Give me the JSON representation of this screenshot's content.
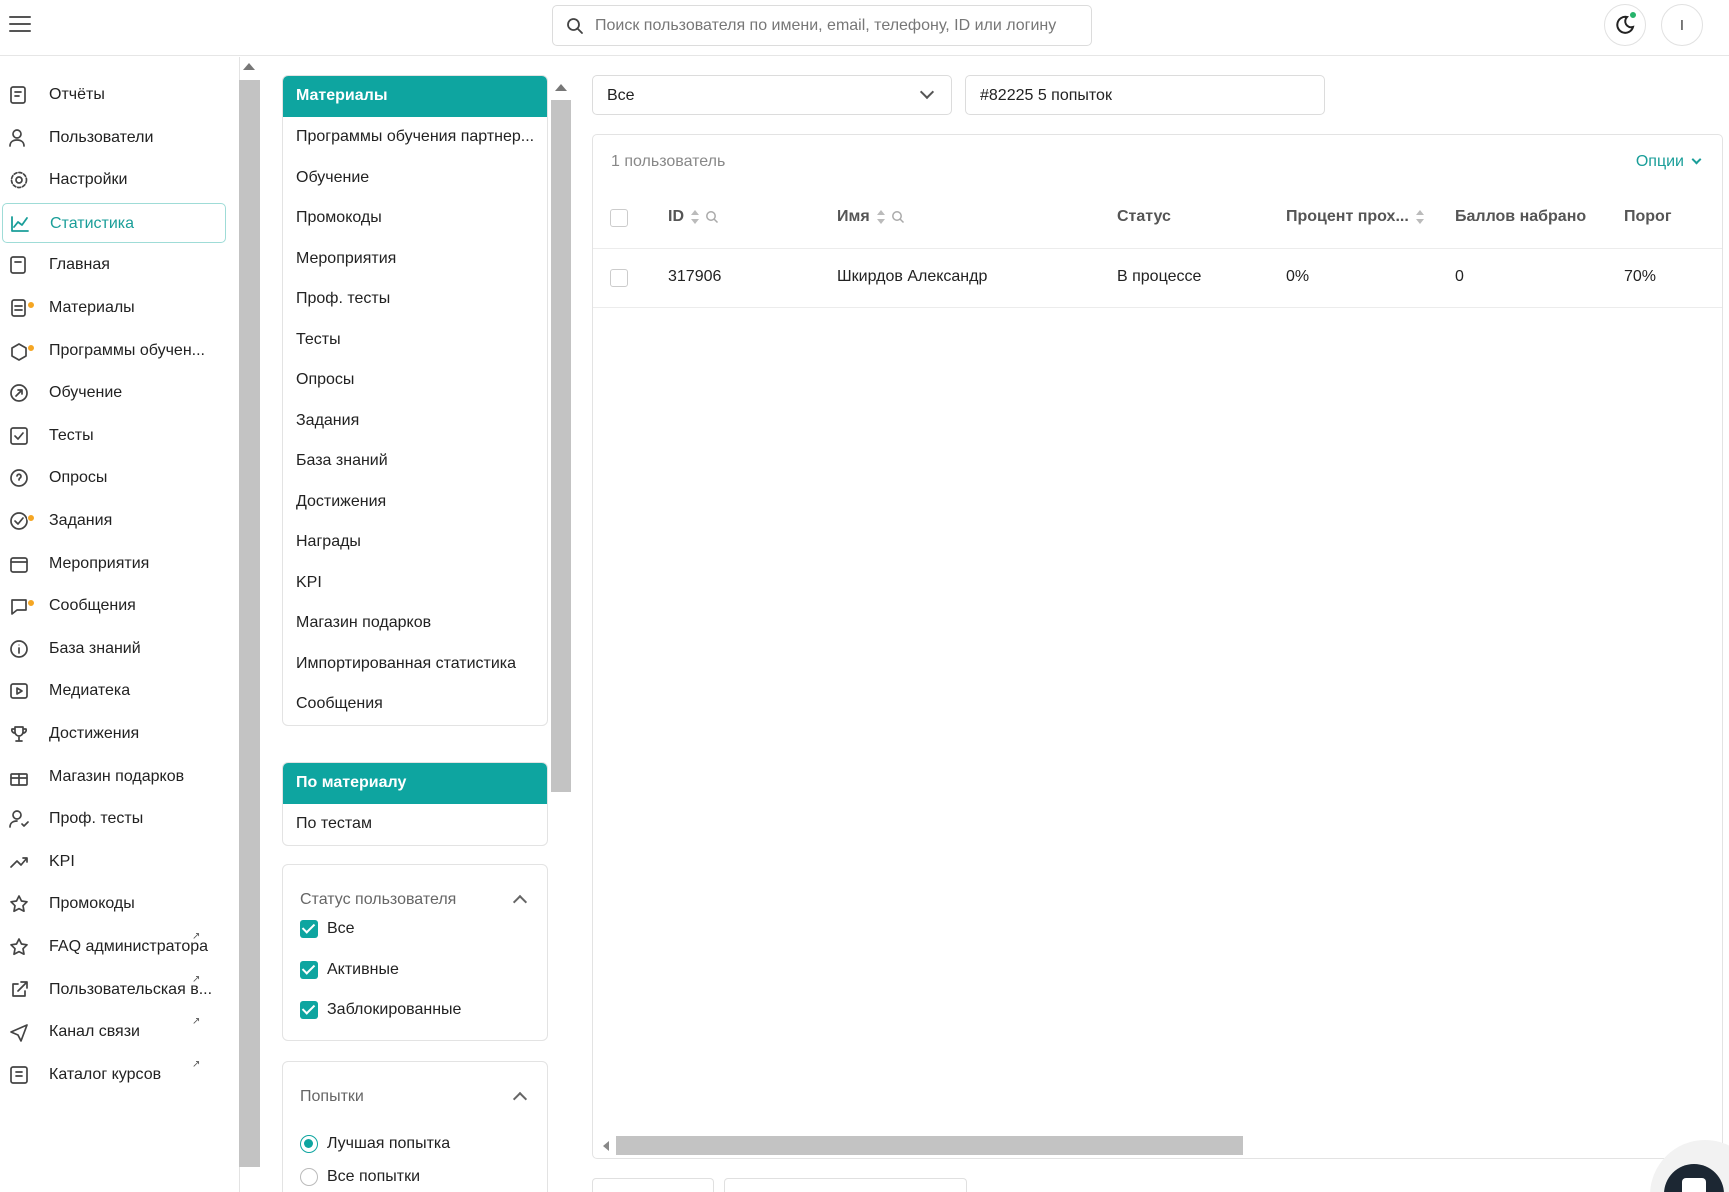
{
  "header": {
    "search_placeholder": "Поиск пользователя по имени, email, телефону, ID или логину",
    "profile_initial": "I"
  },
  "sidebar": {
    "items": [
      {
        "label": "Отчёты",
        "icon": "reports-icon"
      },
      {
        "label": "Пользователи",
        "icon": "users-icon"
      },
      {
        "label": "Настройки",
        "icon": "gear-icon"
      },
      {
        "label": "Статистика",
        "icon": "chart-line-icon",
        "active": true
      },
      {
        "label": "Главная",
        "icon": "home-icon"
      },
      {
        "label": "Материалы",
        "icon": "materials-icon",
        "badge": true
      },
      {
        "label": "Программы обучен...",
        "icon": "programs-icon",
        "badge": true
      },
      {
        "label": "Обучение",
        "icon": "learning-icon"
      },
      {
        "label": "Тесты",
        "icon": "tests-icon"
      },
      {
        "label": "Опросы",
        "icon": "question-icon"
      },
      {
        "label": "Задания",
        "icon": "tasks-icon",
        "badge": true
      },
      {
        "label": "Мероприятия",
        "icon": "calendar-icon"
      },
      {
        "label": "Сообщения",
        "icon": "messages-icon",
        "badge": true
      },
      {
        "label": "База знаний",
        "icon": "info-icon"
      },
      {
        "label": "Медиатека",
        "icon": "media-icon"
      },
      {
        "label": "Достижения",
        "icon": "trophy-icon"
      },
      {
        "label": "Магазин подарков",
        "icon": "gift-icon"
      },
      {
        "label": "Проф. тесты",
        "icon": "prof-tests-icon"
      },
      {
        "label": "KPI",
        "icon": "trend-icon"
      },
      {
        "label": "Промокоды",
        "icon": "star-icon"
      },
      {
        "label": "FAQ администратора",
        "icon": "star-outline-icon",
        "external": true
      },
      {
        "label": "Пользовательская в...",
        "icon": "external-link-icon",
        "external": true
      },
      {
        "label": "Канал связи",
        "icon": "send-icon",
        "external": true
      },
      {
        "label": "Каталог курсов",
        "icon": "catalog-icon",
        "external": true
      }
    ]
  },
  "categories": {
    "title": "Материалы",
    "items": [
      "Программы обучения партнер...",
      "Обучение",
      "Промокоды",
      "Мероприятия",
      "Проф. тесты",
      "Тесты",
      "Опросы",
      "Задания",
      "База знаний",
      "Достижения",
      "Награды",
      "KPI",
      "Магазин подарков",
      "Импортированная статистика",
      "Сообщения"
    ]
  },
  "view_mode": {
    "title": "По материалу",
    "items": [
      "По тестам"
    ]
  },
  "user_status_filter": {
    "title": "Статус пользователя",
    "options": [
      "Все",
      "Активные",
      "Заблокированные"
    ]
  },
  "attempts_filter": {
    "title": "Попытки",
    "options": [
      "Лучшая попытка",
      "Все попытки"
    ],
    "selected": "Лучшая попытка"
  },
  "toolbar": {
    "select_value": "Все",
    "material_value": "#82225 5 попыток"
  },
  "table": {
    "count_label": "1 пользователь",
    "options_label": "Опции",
    "columns": [
      "ID",
      "Имя",
      "Статус",
      "Процент прох...",
      "Баллов набрано",
      "Порог"
    ],
    "rows": [
      {
        "id": "317906",
        "name": "Шкирдов Александр",
        "status": "В процессе",
        "percent": "0%",
        "score": "0",
        "threshold": "70%"
      }
    ]
  },
  "colors": {
    "accent": "#0ea5a0",
    "badge": "#f5a623",
    "online": "#27b36b"
  }
}
